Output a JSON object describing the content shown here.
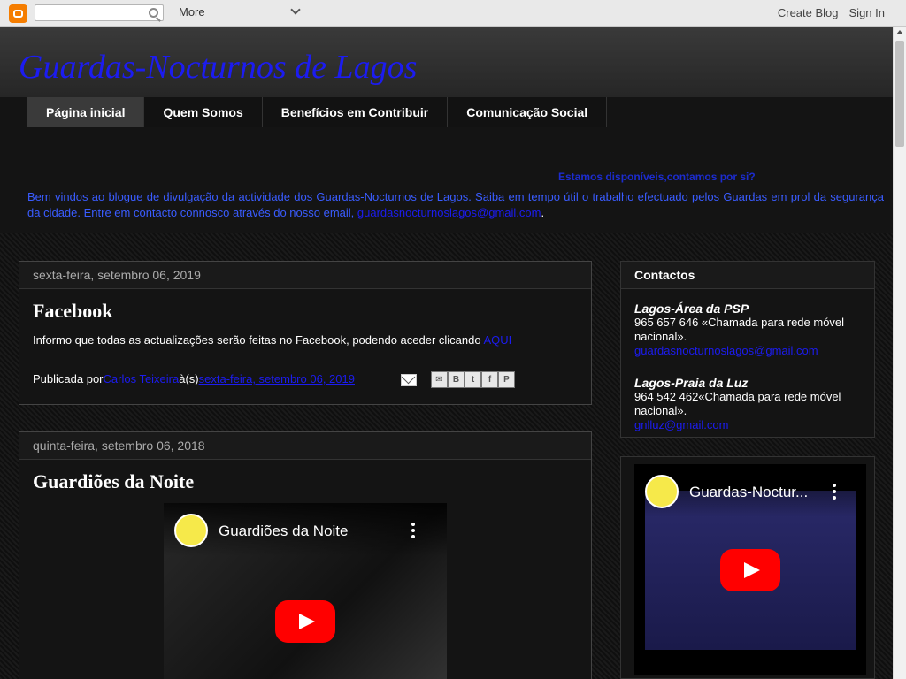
{
  "navbar": {
    "more_label": "More",
    "create_blog": "Create Blog",
    "sign_in": "Sign In"
  },
  "header": {
    "title": "Guardas-Nocturnos de Lagos"
  },
  "tabs": [
    {
      "label": "Página inicial"
    },
    {
      "label": "Quem Somos"
    },
    {
      "label": "Benefícios em Contribuir"
    },
    {
      "label": "Comunicação Social"
    }
  ],
  "description": {
    "marquee": "Estamos disponíveis,contamos por si?",
    "text": "Bem vindos ao blogue de divulgação da actividade dos Guardas-Nocturnos de Lagos. Saiba em tempo útil o trabalho efectuado pelos Guardas em prol da segurança da cidade. Entre em contacto connosco através do nosso email, ",
    "email": "guardasnocturnoslagos@gmail.com",
    "end": "."
  },
  "posts": [
    {
      "date": "sexta-feira, setembro 06, 2019",
      "title": "Facebook",
      "body": "Informo que todas as actualizações serão feitas no Facebook, podendo aceder clicando ",
      "body_link": "AQUI",
      "published_by": "Publicada por ",
      "author": "Carlos Teixeira",
      "at": " à(s) ",
      "timestamp": "sexta-feira, setembro 06, 2019"
    },
    {
      "date": "quinta-feira, setembro 06, 2018",
      "title": "Guardiões da Noite",
      "video_title": "Guardiões da Noite"
    }
  ],
  "sidebar": {
    "contacts_title": "Contactos",
    "contact1_name": "Lagos-Área da PSP",
    "contact1_phone": "965 657 646 «Chamada para rede móvel nacional».",
    "contact1_email": "guardasnocturnoslagos@gmail.com",
    "contact2_name": "Lagos-Praia da Luz",
    "contact2_phone": "964 542 462«Chamada para rede móvel nacional».",
    "contact2_email": "gnlluz@gmail.com",
    "video_title": "Guardas-Noctur..."
  }
}
